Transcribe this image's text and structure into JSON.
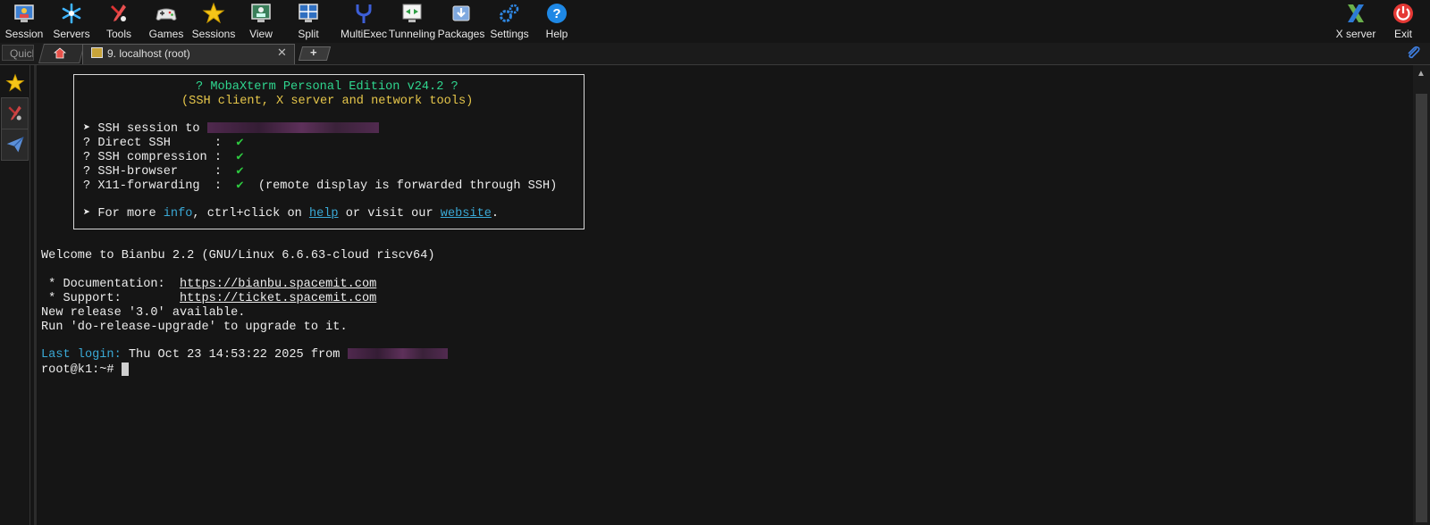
{
  "toolbar": {
    "left": [
      {
        "label": "Session",
        "icon": "session-icon"
      },
      {
        "label": "Servers",
        "icon": "servers-icon"
      },
      {
        "label": "Tools",
        "icon": "tools-icon"
      },
      {
        "label": "Games",
        "icon": "games-icon"
      },
      {
        "label": "Sessions",
        "icon": "star-icon"
      },
      {
        "label": "View",
        "icon": "view-icon"
      },
      {
        "label": "Split",
        "icon": "split-icon"
      },
      {
        "label": "MultiExec",
        "icon": "multiexec-icon"
      },
      {
        "label": "Tunneling",
        "icon": "tunneling-icon"
      },
      {
        "label": "Packages",
        "icon": "packages-icon"
      },
      {
        "label": "Settings",
        "icon": "settings-icon"
      },
      {
        "label": "Help",
        "icon": "help-icon"
      }
    ],
    "right": [
      {
        "label": "X server",
        "icon": "x-server-icon"
      },
      {
        "label": "Exit",
        "icon": "exit-icon"
      }
    ]
  },
  "tabs": {
    "quick_connect_placeholder": "Quick connect...",
    "session_tab_title": "9. localhost (root)",
    "close_glyph": "✕",
    "add_glyph": "+"
  },
  "terminal": {
    "banner_title": "? MobaXterm Personal Edition v24.2 ?",
    "banner_subtitle": "(SSH client, X server and network tools)",
    "ssh_session_prefix": "➤ SSH session to ",
    "features": [
      {
        "name": "? Direct SSH      :  ",
        "value": "✔",
        "note": ""
      },
      {
        "name": "? SSH compression :  ",
        "value": "✔",
        "note": ""
      },
      {
        "name": "? SSH-browser     :  ",
        "value": "✔",
        "note": ""
      },
      {
        "name": "? X11-forwarding  :  ",
        "value": "✔",
        "note": "  (remote display is forwarded through SSH)"
      }
    ],
    "more_prefix": "➤ For more ",
    "more_info": "info",
    "more_mid": ", ctrl+click on ",
    "more_help": "help",
    "more_mid2": " or visit our ",
    "more_website": "website",
    "more_end": ".",
    "welcome": "Welcome to Bianbu 2.2 (GNU/Linux 6.6.63-cloud riscv64)",
    "doc_label": " * Documentation:  ",
    "doc_url": "https://bianbu.spacemit.com",
    "support_label": " * Support:        ",
    "support_url": "https://ticket.spacemit.com",
    "release": "New release '3.0' available.",
    "upgrade": "Run 'do-release-upgrade' to upgrade to it.",
    "last_login_label": "Last login:",
    "last_login_value": " Thu Oct 23 14:53:22 2025 from ",
    "prompt": "root@k1:~# "
  },
  "colors": {
    "background": "#151515",
    "banner_title": "#2fd68f",
    "banner_subtitle": "#e6c64a",
    "link": "#3aa9d6",
    "check": "#2ecc40"
  }
}
